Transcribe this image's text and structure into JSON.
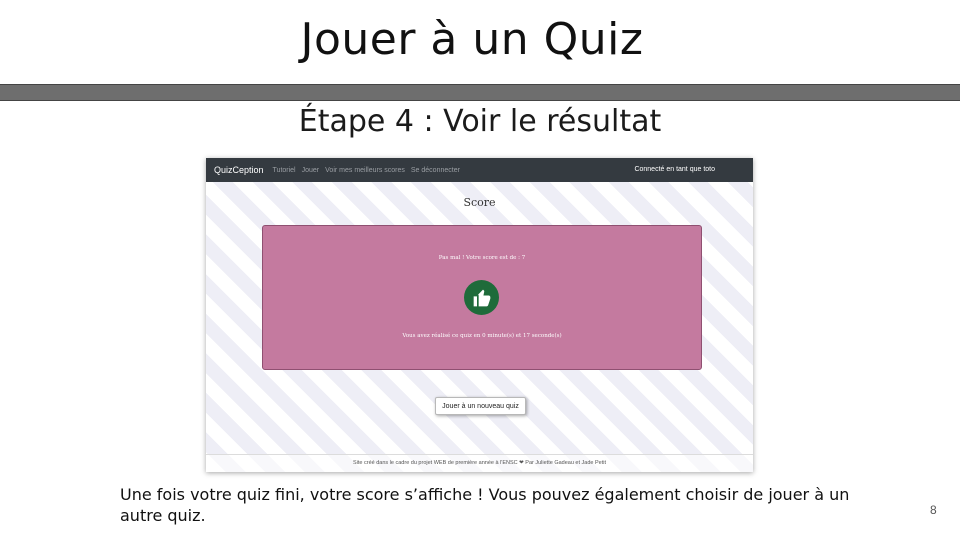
{
  "slide": {
    "title": "Jouer à un Quiz",
    "subtitle": "Étape 4 : Voir le résultat",
    "caption": "Une fois votre quiz fini, votre score s’affiche ! Vous pouvez également choisir de jouer à un autre quiz.",
    "page_number": "8"
  },
  "app": {
    "navbar": {
      "brand": "QuizCeption",
      "links": [
        "Tutoriel",
        "Jouer",
        "Voir mes meilleurs scores",
        "Se déconnecter"
      ],
      "user_status": "Connecté en tant que toto"
    },
    "score_heading": "Score",
    "result": {
      "message": "Pas mal ! Votre score est de : 7",
      "icon": "thumbs-up-icon",
      "time": "Vous avez réalisé ce quiz en 0 minute(s) et 17 seconde(s)"
    },
    "new_quiz_button": "Jouer à un nouveau quiz",
    "footer": "Site créé dans le cadre du projet WEB de première année à l'ENSC ❤ Par Juliette Gadeau et Jade Petit"
  },
  "colors": {
    "navbar_bg": "#343a40",
    "result_box_bg": "#c47a9f",
    "thumb_circle": "#1e6b3a",
    "divider": "#6e6e6e"
  }
}
